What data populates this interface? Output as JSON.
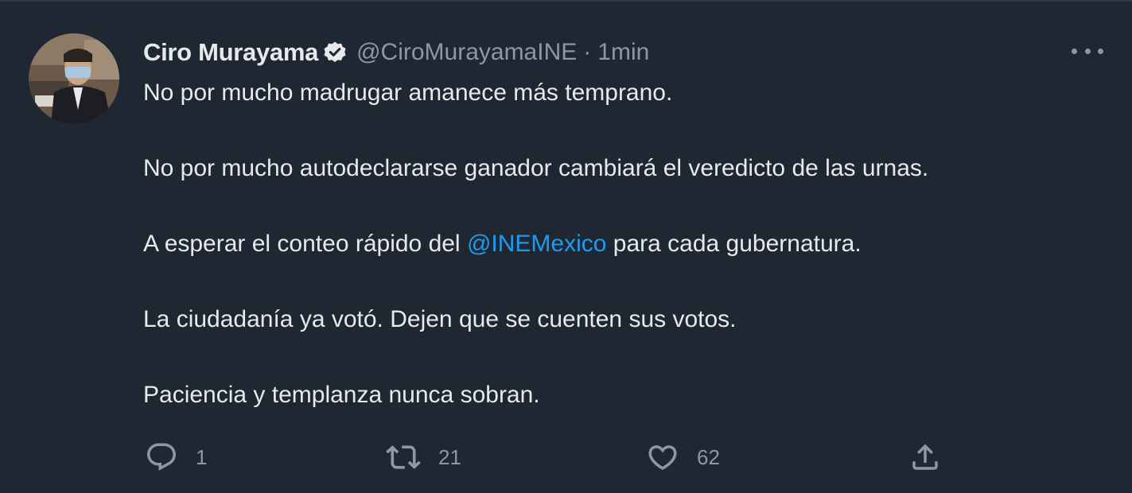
{
  "author": {
    "display_name": "Ciro Murayama",
    "handle": "@CiroMurayamaINE",
    "separator": "·",
    "time": "1min",
    "verified": true,
    "avatar_icon": "profile-photo"
  },
  "tweet": {
    "line1": "No por mucho madrugar amanece más temprano.",
    "line2": "No por mucho autodeclararse ganador cambiará el veredicto de las urnas.",
    "line3_before": "A esperar el conteo rápido del ",
    "line3_mention": "@INEMexico",
    "line3_after": " para cada gubernatura.",
    "line4": "La ciudadanía ya votó. Dejen que se cuenten sus votos.",
    "line5": "Paciencia y templanza nunca sobran."
  },
  "actions": {
    "reply": {
      "icon": "reply-icon",
      "count": "1"
    },
    "retweet": {
      "icon": "retweet-icon",
      "count": "21"
    },
    "like": {
      "icon": "heart-icon",
      "count": "62"
    },
    "share": {
      "icon": "share-icon"
    }
  },
  "colors": {
    "background": "#1e2732",
    "text": "#e7e9ea",
    "muted": "#8b98a5",
    "link": "#1d9bf0"
  }
}
